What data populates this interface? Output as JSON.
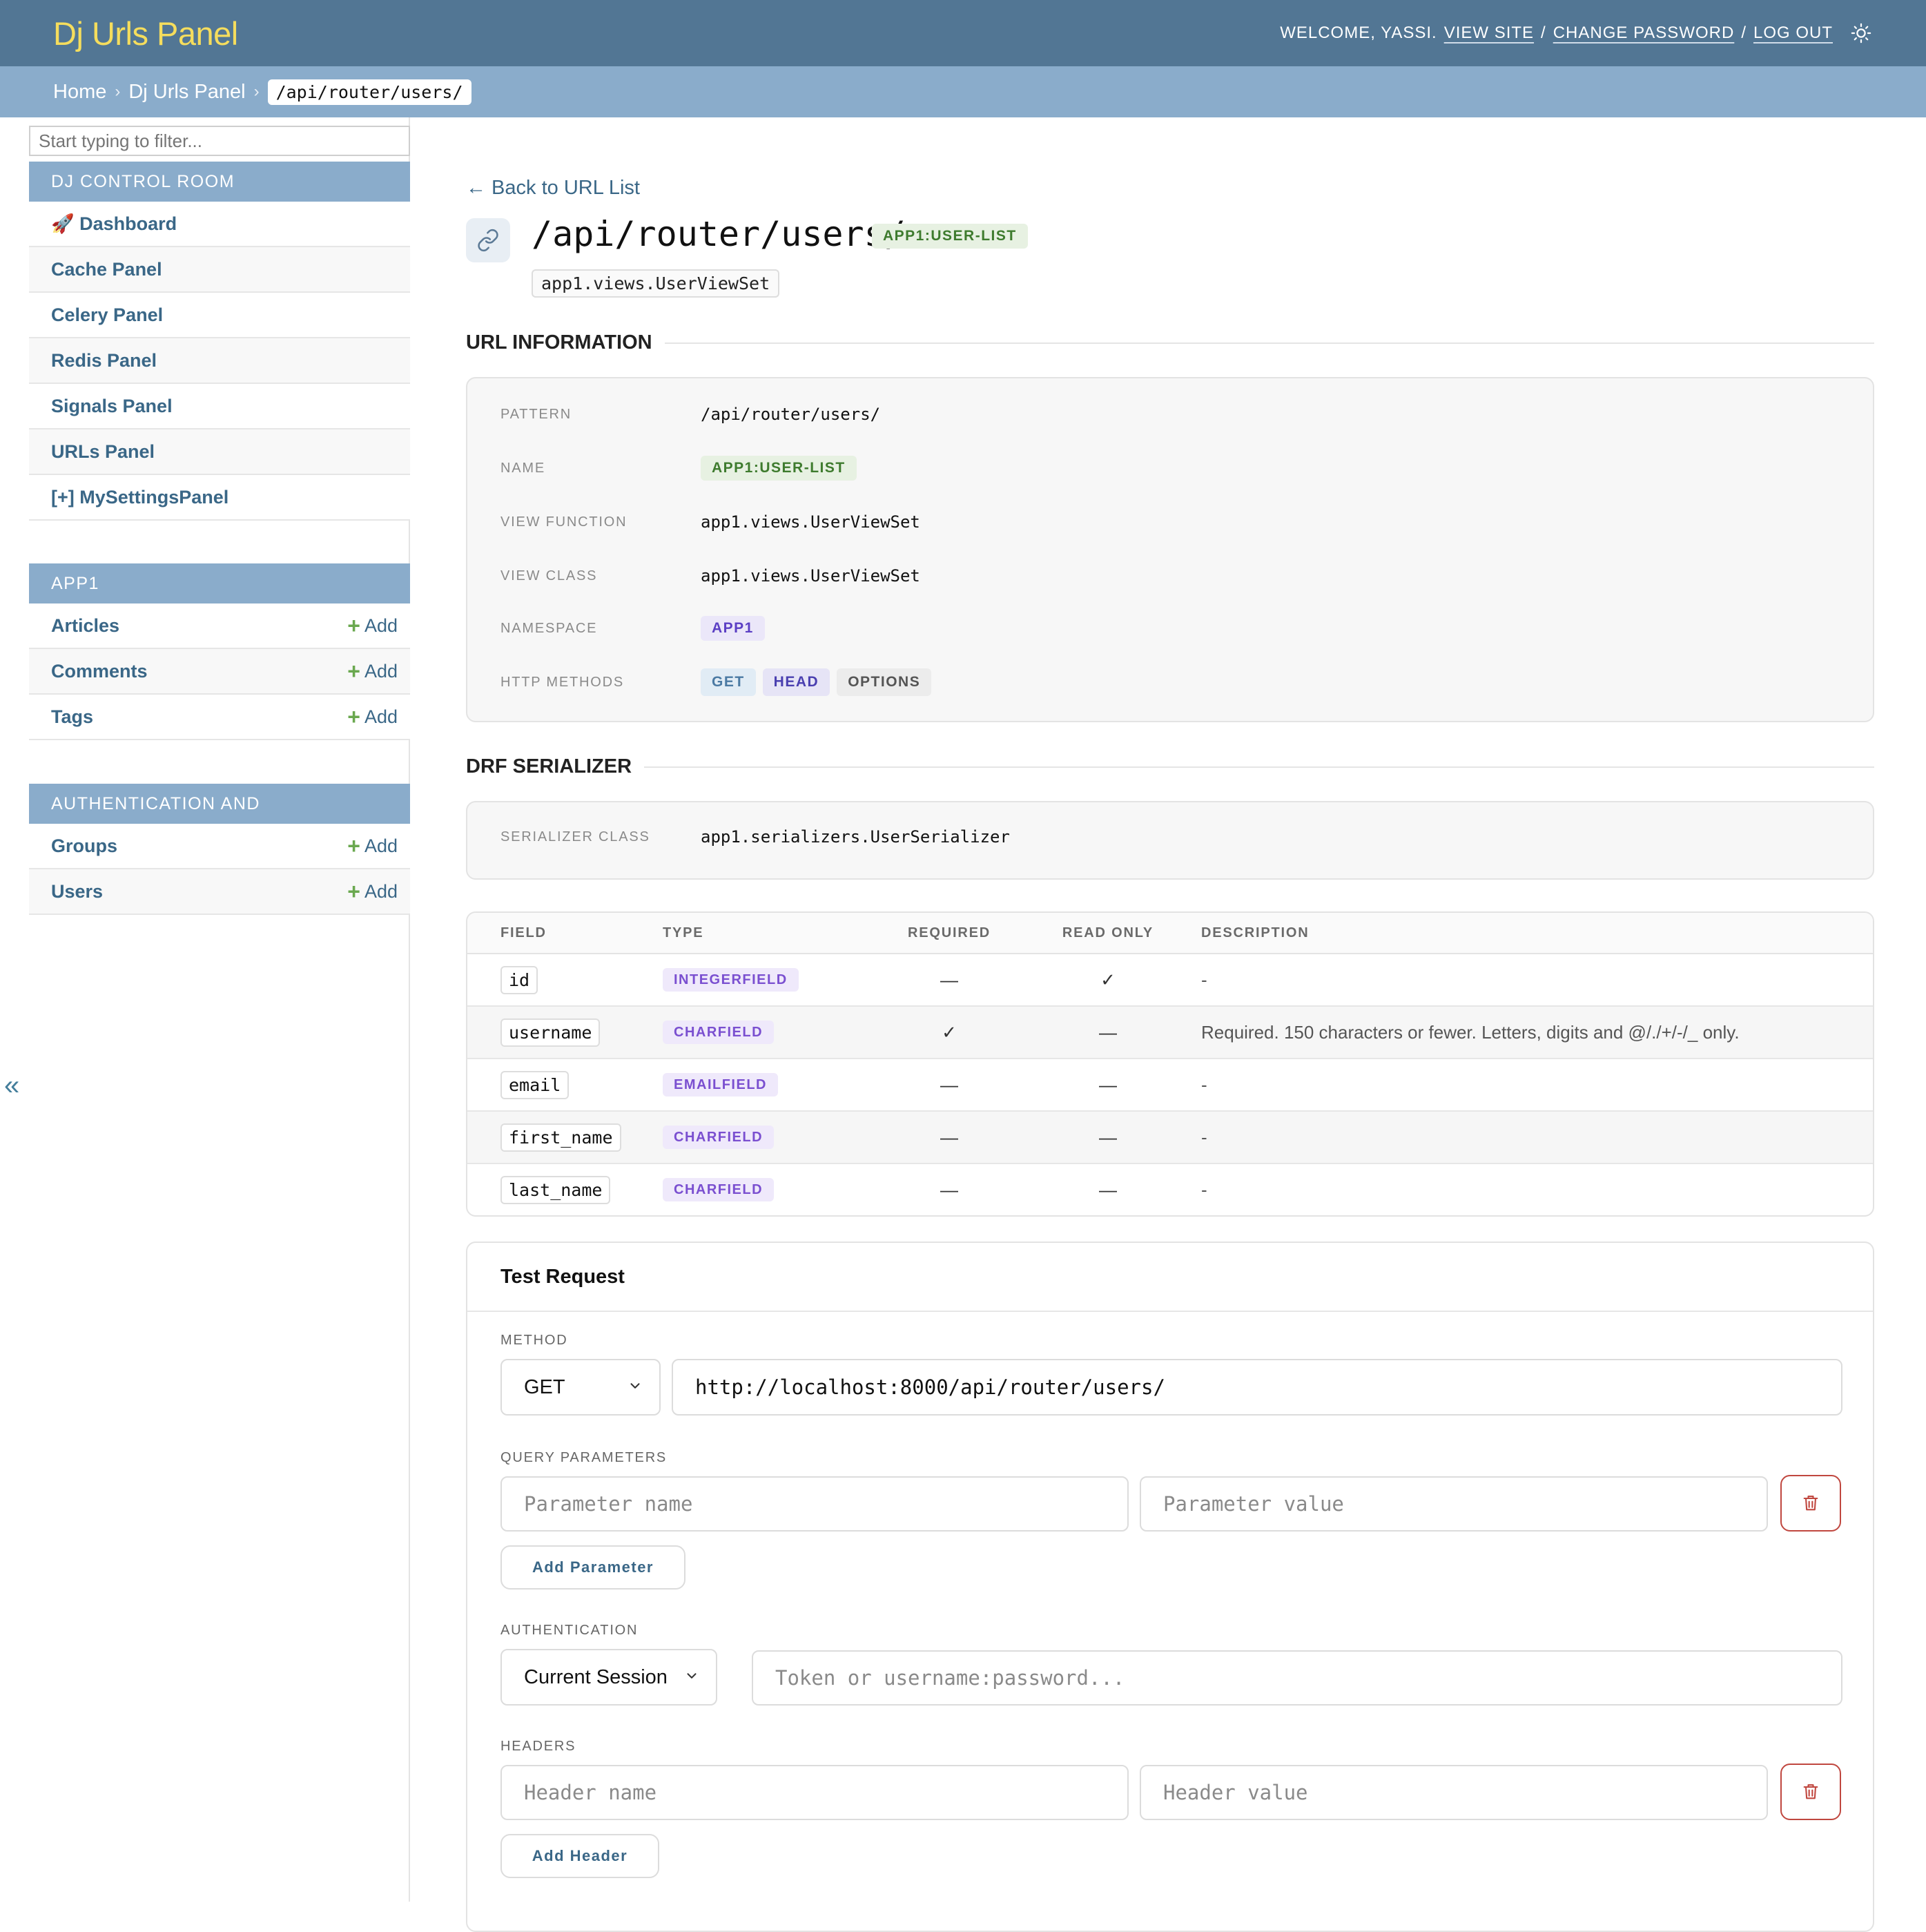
{
  "header": {
    "branding": "Dj Urls Panel",
    "welcome": "WELCOME, YASSI.",
    "view_site": "VIEW SITE",
    "change_password": "CHANGE PASSWORD",
    "log_out": "LOG OUT",
    "sep": "/",
    "theme_icon": "sun-icon"
  },
  "breadcrumbs": {
    "home": "Home",
    "panel": "Dj Urls Panel",
    "current": "/api/router/users/",
    "arrow": "›"
  },
  "sidebar": {
    "filter_placeholder": "Start typing to filter...",
    "collapse_glyph": "«",
    "modules": [
      {
        "caption": "DJ CONTROL ROOM",
        "items": [
          {
            "label": "🚀 Dashboard"
          },
          {
            "label": "Cache Panel"
          },
          {
            "label": "Celery Panel"
          },
          {
            "label": "Redis Panel"
          },
          {
            "label": "Signals Panel"
          },
          {
            "label": "URLs Panel"
          },
          {
            "label": "[+] MySettingsPanel"
          }
        ]
      },
      {
        "caption": "APP1",
        "items": [
          {
            "label": "Articles",
            "add": "Add"
          },
          {
            "label": "Comments",
            "add": "Add"
          },
          {
            "label": "Tags",
            "add": "Add"
          }
        ]
      },
      {
        "caption": "AUTHENTICATION AND AUTHORIZATION",
        "items": [
          {
            "label": "Groups",
            "add": "Add"
          },
          {
            "label": "Users",
            "add": "Add"
          }
        ]
      }
    ]
  },
  "main": {
    "back_link": "← Back to URL List",
    "title": "/api/router/users/",
    "title_badge": "APP1:USER-LIST",
    "view_chip": "app1.views.UserViewSet",
    "url_info_heading": "URL INFORMATION",
    "url_info": {
      "pattern_label": "PATTERN",
      "pattern": "/api/router/users/",
      "name_label": "NAME",
      "name": "APP1:USER-LIST",
      "view_function_label": "VIEW FUNCTION",
      "view_function": "app1.views.UserViewSet",
      "view_class_label": "VIEW CLASS",
      "view_class": "app1.views.UserViewSet",
      "namespace_label": "NAMESPACE",
      "namespace": "APP1",
      "http_methods_label": "HTTP METHODS",
      "methods": [
        "GET",
        "HEAD",
        "OPTIONS"
      ]
    },
    "drf_heading": "DRF SERIALIZER",
    "serializer_label": "SERIALIZER CLASS",
    "serializer_class": "app1.serializers.UserSerializer",
    "fields_table": {
      "headers": [
        "FIELD",
        "TYPE",
        "REQUIRED",
        "READ ONLY",
        "DESCRIPTION"
      ],
      "rows": [
        {
          "field": "id",
          "type": "INTEGERFIELD",
          "required": "—",
          "read_only": "✓",
          "description": "-"
        },
        {
          "field": "username",
          "type": "CHARFIELD",
          "required": "✓",
          "read_only": "—",
          "description": "Required. 150 characters or fewer. Letters, digits and @/./+/-/_ only."
        },
        {
          "field": "email",
          "type": "EMAILFIELD",
          "required": "—",
          "read_only": "—",
          "description": "-"
        },
        {
          "field": "first_name",
          "type": "CHARFIELD",
          "required": "—",
          "read_only": "—",
          "description": "-"
        },
        {
          "field": "last_name",
          "type": "CHARFIELD",
          "required": "—",
          "read_only": "—",
          "description": "-"
        }
      ]
    },
    "test_request": {
      "title": "Test Request",
      "method_label": "METHOD",
      "method_value": "GET",
      "url_value": "http://localhost:8000/api/router/users/",
      "query_label": "QUERY PARAMETERS",
      "param_name_placeholder": "Parameter name",
      "param_value_placeholder": "Parameter value",
      "add_param": "Add Parameter",
      "auth_label": "AUTHENTICATION",
      "auth_value": "Current Session",
      "token_placeholder": "Token or username:password...",
      "headers_label": "HEADERS",
      "header_name_placeholder": "Header name",
      "header_value_placeholder": "Header value",
      "add_header": "Add Header"
    }
  }
}
